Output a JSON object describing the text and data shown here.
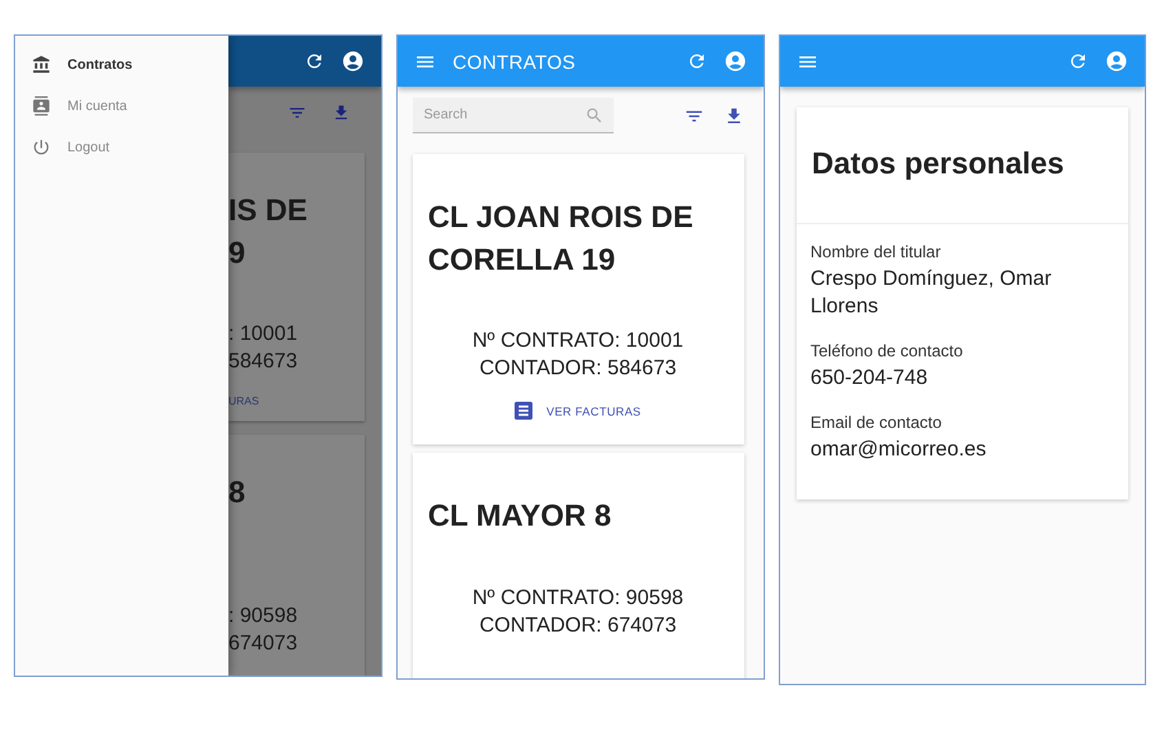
{
  "drawer_screen": {
    "menu": [
      {
        "label": "Contratos",
        "selected": true
      },
      {
        "label": "Mi cuenta",
        "selected": false
      },
      {
        "label": "Logout",
        "selected": false
      }
    ],
    "background_cards": [
      {
        "title_lines": [
          "IS DE",
          "9"
        ],
        "lines": [
          ": 10001",
          "584673"
        ],
        "link": "URAS"
      },
      {
        "title_lines": [
          "8"
        ],
        "lines": [
          ": 90598",
          "674073"
        ]
      }
    ]
  },
  "contracts_screen": {
    "app_bar": {
      "title": "CONTRATOS"
    },
    "search": {
      "placeholder": "Search"
    },
    "contracts": [
      {
        "address": "CL JOAN ROIS DE CORELLA 19",
        "contract_number": "Nº CONTRATO: 10001",
        "meter": "CONTADOR: 584673",
        "link": "VER FACTURAS"
      },
      {
        "address": "CL MAYOR 8",
        "contract_number": "Nº CONTRATO: 90598",
        "meter": "CONTADOR: 674073"
      }
    ]
  },
  "profile_screen": {
    "title": "Datos personales",
    "fields": [
      {
        "label": "Nombre del titular",
        "value": "Crespo Domínguez, Omar Llorens"
      },
      {
        "label": "Teléfono de contacto",
        "value": "650-204-748"
      },
      {
        "label": "Email de contacto",
        "value": "omar@micorreo.es"
      }
    ]
  }
}
